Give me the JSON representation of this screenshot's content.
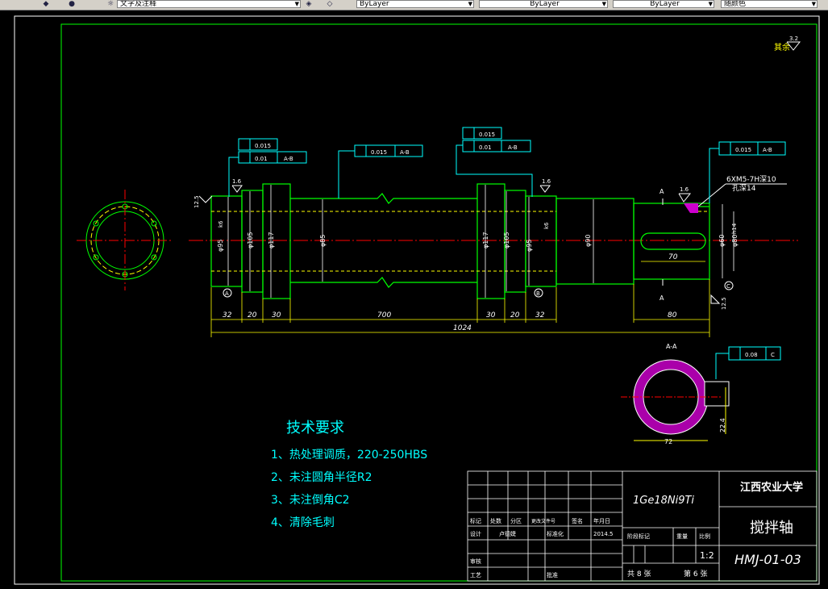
{
  "toolbar": {
    "textstyle_value": "文字及注释",
    "color_value": "ByLayer",
    "linetype_value": "ByLayer",
    "lineweight_value": "ByLayer",
    "plotstyle_value": "随颜色"
  },
  "drawing": {
    "roughness_others_label": "其余",
    "roughness_others_value": "3.2",
    "roughness_values": [
      "1.6",
      "1.6",
      "1.6",
      "12.5",
      "12.5"
    ],
    "tolerance_frames": [
      {
        "value": "0.015",
        "datum": ""
      },
      {
        "value": "0.01",
        "datum": "A-B"
      },
      {
        "value": "0.015",
        "datum": "A-B"
      },
      {
        "value": "0.015",
        "datum": ""
      },
      {
        "value": "0.01",
        "datum": "A-B"
      },
      {
        "value": "0.015",
        "datum": "A-B"
      },
      {
        "value": "0.08",
        "datum": "C"
      }
    ],
    "diameters": [
      "φ95",
      "φ105",
      "φ117",
      "φ85",
      "φ117",
      "φ105",
      "φ95",
      "φ90",
      "φ60",
      "φ80"
    ],
    "tolerance_marks": [
      "k6",
      "k6",
      "h14"
    ],
    "dims_lengths": [
      "32",
      "20",
      "30",
      "700",
      "30",
      "20",
      "32",
      "80",
      "1024",
      "70",
      "72",
      "22.4"
    ],
    "thread_note": "6XM5-7H深10",
    "thread_note2": "孔深14",
    "section_mark": "A",
    "section_title": "A-A",
    "datum_labels": [
      "A",
      "B",
      "C"
    ]
  },
  "requirements": {
    "title": "技术要求",
    "items": [
      "1、热处理调质，220-250HBS",
      "2、未注圆角半径R2",
      "3、未注倒角C2",
      "4、清除毛刺"
    ]
  },
  "title_block": {
    "material": "1Ge18Ni9Ti",
    "school": "江西农业大学",
    "part_name": "搅拌轴",
    "drawing_no": "HMJ-01-03",
    "scale": "1:2",
    "date": "2014.5",
    "designer_label": "设计",
    "designer": "卢德婕",
    "standardize_label": "标准化",
    "craft_label": "工艺",
    "approve_label": "批准",
    "check_label": "审核",
    "total_sheets": "共 8 张",
    "sheet_no": "第 6 张",
    "stage_label": "阶段标记",
    "weight_label": "重量",
    "scale_label": "比例",
    "mark_label": "标记",
    "count_label": "处数",
    "zone_label": "分区",
    "change_doc_label": "更改文件号",
    "sign_label": "签名",
    "ymd_label": "年月日"
  }
}
